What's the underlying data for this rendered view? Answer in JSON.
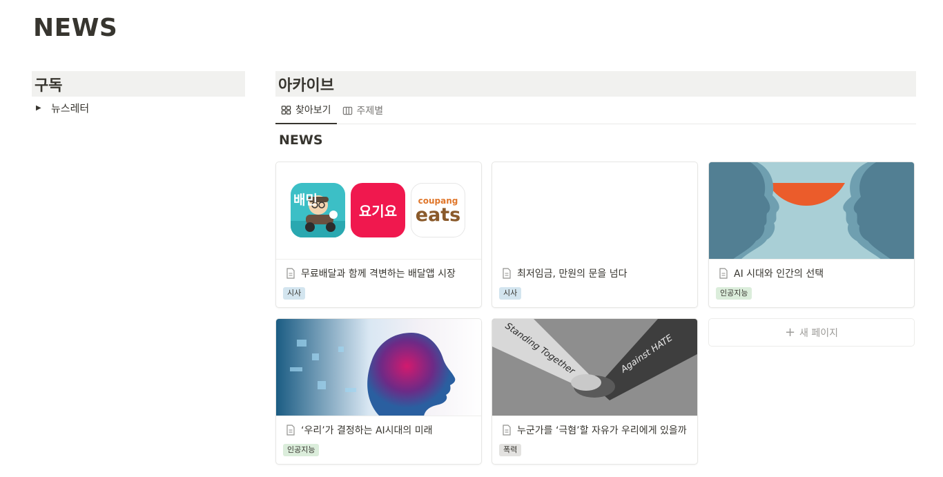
{
  "page": {
    "title": "NEWS"
  },
  "subscribe": {
    "heading": "구독",
    "toggle_label": "뉴스레터"
  },
  "archive": {
    "heading": "아카이브",
    "tabs": [
      {
        "label": "찾아보기",
        "icon": "gallery-icon",
        "active": true
      },
      {
        "label": "주제별",
        "icon": "board-icon",
        "active": false
      }
    ],
    "database_title": "NEWS",
    "cards": [
      {
        "title": "무료배달과 함께 격변하는 배달앱 시장",
        "tag": "시사",
        "tag_color": "#d3e5ef",
        "cover": "delivery-app-logos"
      },
      {
        "title": "최저임금, 만원의 문을 넘다",
        "tag": "시사",
        "tag_color": "#d3e5ef",
        "cover": "blank"
      },
      {
        "title": "AI 시대와 인간의 선택",
        "tag": "인공지능",
        "tag_color": "#dbeddb",
        "cover": "two-faces-illustration"
      },
      {
        "title": "‘우리’가 결정하는 AI시대의 미래",
        "tag": "인공지능",
        "tag_color": "#dbeddb",
        "cover": "digital-face-profile"
      },
      {
        "title": "누군가를 ‘극혐’할 자유가 우리에게 있을까",
        "tag": "폭력",
        "tag_color": "#e3e2e0",
        "cover": "handshake-photo"
      }
    ],
    "new_page_label": "새 페이지"
  },
  "cover_logos": {
    "baemin_text": "배민",
    "yogiyo_text": "요기요",
    "coupang_text": "coupang",
    "eats_text": "eats"
  },
  "handshake_words": {
    "left_arm": "Standing Together",
    "right_arm": "Against HATE"
  },
  "colors": {
    "text": "#37352f",
    "muted": "#787774",
    "section_bg": "#f1f1ef",
    "yogiyo_red": "#f0184e",
    "baemin_teal": "#3fc1c9",
    "coupang_orange": "#e0762a",
    "eats_brown": "#8a5a2b"
  }
}
